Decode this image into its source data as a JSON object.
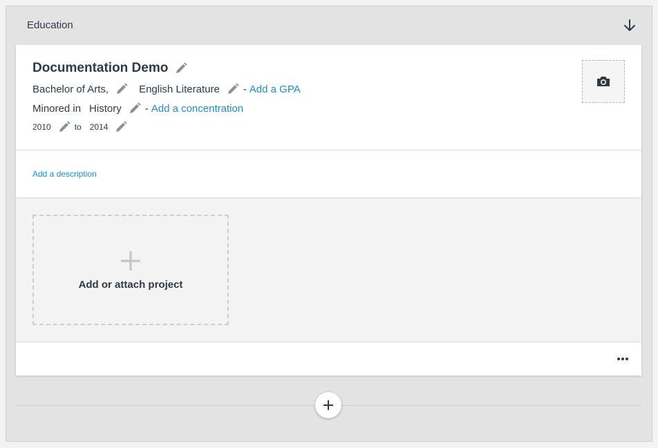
{
  "section": {
    "title": "Education"
  },
  "entry": {
    "school": "Documentation Demo",
    "degree": "Bachelor of Arts,",
    "major": "English Literature",
    "gpa_link": "Add a GPA",
    "minor_prefix": "Minored in",
    "minor": "History",
    "concentration_link": "Add a concentration",
    "separator": "-",
    "start_year": "2010",
    "to_label": "to",
    "end_year": "2014"
  },
  "description": {
    "link": "Add a description"
  },
  "projects": {
    "add_label": "Add or attach project"
  },
  "colors": {
    "accent": "#1f8ad6",
    "text": "#2d3b45",
    "icon": "#8b9196"
  },
  "icons": {
    "collapse": "arrow-down-icon",
    "edit": "pencil-icon",
    "photo": "camera-icon",
    "add": "plus-icon",
    "more": "ellipsis-icon"
  }
}
